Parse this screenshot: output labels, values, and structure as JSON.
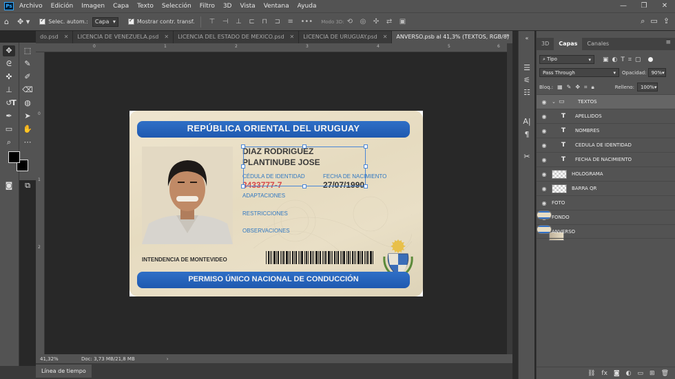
{
  "app": {
    "logo": "Ps"
  },
  "menu": [
    "Archivo",
    "Edición",
    "Imagen",
    "Capa",
    "Texto",
    "Selección",
    "Filtro",
    "3D",
    "Vista",
    "Ventana",
    "Ayuda"
  ],
  "options": {
    "auto_select_label": "Selec. autom.:",
    "auto_select_value": "Capa",
    "show_transform_label": "Mostrar contr. transf.",
    "mode_3d_label": "Modo 3D:"
  },
  "tabs": [
    {
      "label": "do.psd"
    },
    {
      "label": "LICENCIA DE VENEZUELA.psd"
    },
    {
      "label": "LICENCIA DEL ESTADO DE MEXICO.psd"
    },
    {
      "label": "LICENCIA DE URUGUAY.psd"
    },
    {
      "label": "ANVERSO.psb al 41,3% (TEXTOS, RGB/8)"
    }
  ],
  "ruler": {
    "top": [
      "0",
      "1",
      "2",
      "3",
      "4",
      "5",
      "6"
    ],
    "left": [
      "0",
      "1",
      "2"
    ]
  },
  "card": {
    "header": "REPÚBLICA ORIENTAL DEL URUGUAY",
    "surname": "DIAZ RODRIGUEZ",
    "given_names": "PLANTINUBE JOSE",
    "ci_label": "CÉDULA DE IDENTIDAD",
    "ci_value": "3433777-7",
    "dob_label": "FECHA DE NACIMIENTO",
    "dob_value": "27/07/1990",
    "adaptaciones": "ADAPTACIONES",
    "restricciones": "RESTRICCIONES",
    "observaciones": "OBSERVACIONES",
    "issuer": "INTENDENCIA DE MONTEVIDEO",
    "footer": "PERMISO ÚNICO NACIONAL DE CONDUCCIÓN"
  },
  "status": {
    "zoom": "41,32%",
    "doc_info": "Doc: 3,73 MB/21,8 MB"
  },
  "timeline": {
    "label": "Línea de tiempo"
  },
  "panel": {
    "tabs": [
      "3D",
      "Capas",
      "Canales"
    ],
    "filter_label": "Tipo",
    "blend_mode": "Pass Through",
    "opacity_label": "Opacidad:",
    "opacity_value": "90%",
    "lock_label": "Bloq.:",
    "fill_label": "Relleno:",
    "fill_value": "100%",
    "layers": [
      {
        "name": "TEXTOS",
        "kind": "group",
        "visible": true
      },
      {
        "name": "APELLIDOS",
        "kind": "text",
        "visible": true
      },
      {
        "name": "NOMBRES",
        "kind": "text",
        "visible": true
      },
      {
        "name": "CEDULA DE IDENTIDAD",
        "kind": "text",
        "visible": true
      },
      {
        "name": "FECHA DE NACIMIENTO",
        "kind": "text",
        "visible": true
      },
      {
        "name": "HOLOGRAMA",
        "kind": "image",
        "visible": true
      },
      {
        "name": "BARRA QR",
        "kind": "image",
        "visible": true
      },
      {
        "name": "FOTO",
        "kind": "image",
        "visible": true
      },
      {
        "name": "FONDO",
        "kind": "image",
        "visible": true
      },
      {
        "name": "ANVERSO",
        "kind": "image",
        "visible": false
      }
    ]
  },
  "colors": {
    "accent": "#2f6fc6",
    "ps_blue": "#31a8ff",
    "selection": "#4a86d6"
  }
}
